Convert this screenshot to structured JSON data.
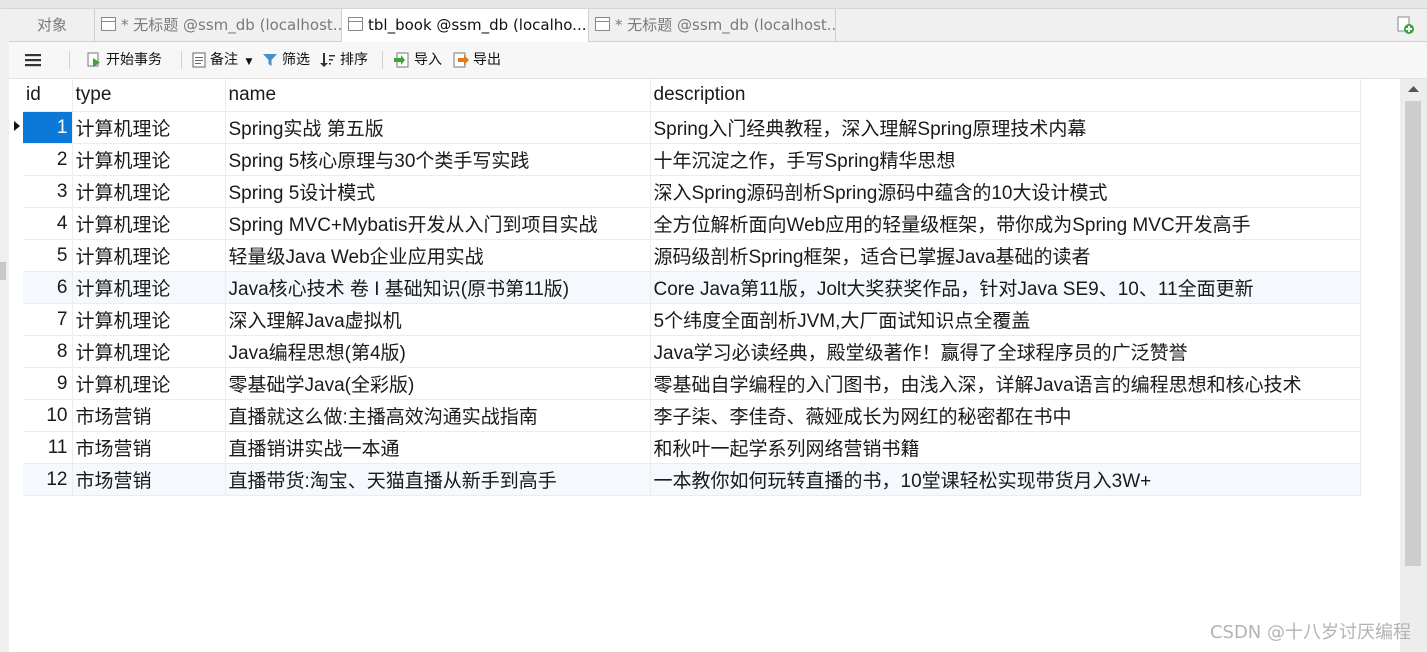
{
  "tabs": [
    {
      "label": "对象"
    },
    {
      "label": "* 无标题 @ssm_db (localhost..."
    },
    {
      "label": "tbl_book @ssm_db (localho..."
    },
    {
      "label": "* 无标题 @ssm_db (localhost..."
    }
  ],
  "toolbar": {
    "begin_transaction": "开始事务",
    "memo": "备注",
    "filter": "筛选",
    "sort": "排序",
    "import": "导入",
    "export": "导出"
  },
  "grid": {
    "columns": [
      "id",
      "type",
      "name",
      "description"
    ],
    "rows": [
      [
        "1",
        "计算机理论",
        "Spring实战 第五版",
        "Spring入门经典教程，深入理解Spring原理技术内幕"
      ],
      [
        "2",
        "计算机理论",
        "Spring 5核心原理与30个类手写实践",
        "十年沉淀之作，手写Spring精华思想"
      ],
      [
        "3",
        "计算机理论",
        "Spring 5设计模式",
        "深入Spring源码剖析Spring源码中蕴含的10大设计模式"
      ],
      [
        "4",
        "计算机理论",
        "Spring MVC+Mybatis开发从入门到项目实战",
        "全方位解析面向Web应用的轻量级框架，带你成为Spring MVC开发高手"
      ],
      [
        "5",
        "计算机理论",
        "轻量级Java Web企业应用实战",
        "源码级剖析Spring框架，适合已掌握Java基础的读者"
      ],
      [
        "6",
        "计算机理论",
        "Java核心技术 卷 I  基础知识(原书第11版)",
        "Core Java第11版，Jolt大奖获奖作品，针对Java SE9、10、11全面更新"
      ],
      [
        "7",
        "计算机理论",
        "深入理解Java虚拟机",
        "5个纬度全面剖析JVM,大厂面试知识点全覆盖"
      ],
      [
        "8",
        "计算机理论",
        "Java编程思想(第4版)",
        "Java学习必读经典，殿堂级著作！赢得了全球程序员的广泛赞誉"
      ],
      [
        "9",
        "计算机理论",
        "零基础学Java(全彩版)",
        "零基础自学编程的入门图书，由浅入深，详解Java语言的编程思想和核心技术"
      ],
      [
        "10",
        "市场营销",
        "直播就这么做:主播高效沟通实战指南",
        "李子柒、李佳奇、薇娅成长为网红的秘密都在书中"
      ],
      [
        "11",
        "市场营销",
        "直播销讲实战一本通",
        "和秋叶一起学系列网络营销书籍"
      ],
      [
        "12",
        "市场营销",
        "直播带货:淘宝、天猫直播从新手到高手",
        "一本教你如何玩转直播的书，10堂课轻松实现带货月入3W+"
      ]
    ]
  },
  "watermark": "CSDN @十八岁讨厌编程",
  "colors": {
    "selection": "#0c78d8",
    "alt_row": "#f5f9fd"
  },
  "icons": [
    "menu-icon",
    "transaction-icon",
    "memo-icon",
    "filter-icon",
    "sort-icon",
    "import-icon",
    "export-icon",
    "table-tab-icon",
    "new-query-icon"
  ]
}
